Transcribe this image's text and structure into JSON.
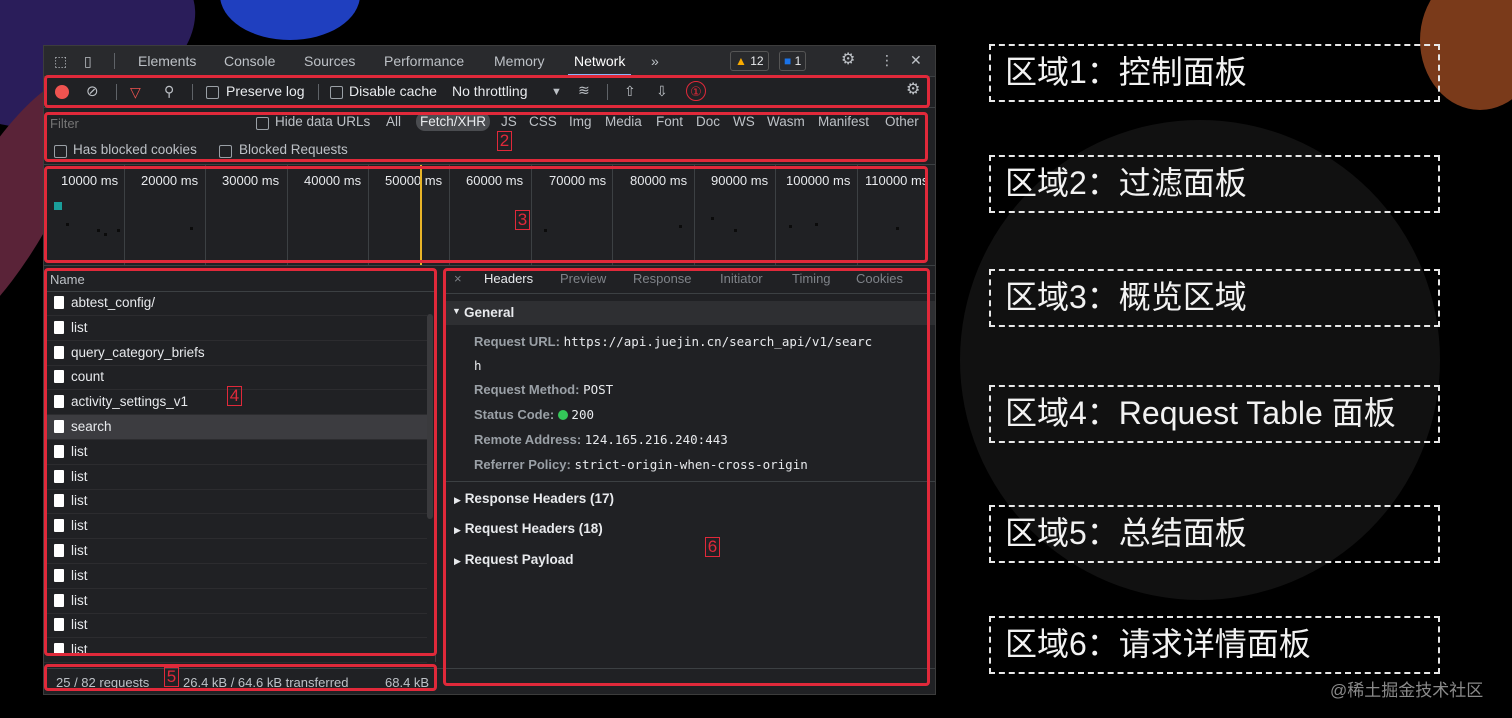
{
  "devtools": {
    "tabs": [
      {
        "label": "Elements",
        "active": false
      },
      {
        "label": "Console",
        "active": false
      },
      {
        "label": "Sources",
        "active": false
      },
      {
        "label": "Performance",
        "active": false
      },
      {
        "label": "Memory",
        "active": false
      },
      {
        "label": "Network",
        "active": true
      }
    ],
    "more_tabs_label": "»",
    "warnings_count": "12",
    "messages_count": "1",
    "toolbar": {
      "preserve_log": "Preserve log",
      "disable_cache": "Disable cache",
      "throttling": "No throttling"
    },
    "filter": {
      "placeholder": "Filter",
      "hide_data_urls": "Hide data URLs",
      "types": [
        "All",
        "Fetch/XHR",
        "JS",
        "CSS",
        "Img",
        "Media",
        "Font",
        "Doc",
        "WS",
        "Wasm",
        "Manifest",
        "Other"
      ],
      "selected_type": "Fetch/XHR",
      "has_blocked_cookies": "Has blocked cookies",
      "blocked_requests": "Blocked Requests"
    },
    "overview": {
      "ticks": [
        "10000 ms",
        "20000 ms",
        "30000 ms",
        "40000 ms",
        "50000 ms",
        "60000 ms",
        "70000 ms",
        "80000 ms",
        "90000 ms",
        "100000 ms",
        "110000 ms"
      ]
    },
    "request_table": {
      "column_name": "Name",
      "rows": [
        {
          "name": "abtest_config/",
          "selected": false
        },
        {
          "name": "list",
          "selected": false
        },
        {
          "name": "query_category_briefs",
          "selected": false
        },
        {
          "name": "count",
          "selected": false
        },
        {
          "name": "activity_settings_v1",
          "selected": false
        },
        {
          "name": "search",
          "selected": true
        },
        {
          "name": "list",
          "selected": false
        },
        {
          "name": "list",
          "selected": false
        },
        {
          "name": "list",
          "selected": false
        },
        {
          "name": "list",
          "selected": false
        },
        {
          "name": "list",
          "selected": false
        },
        {
          "name": "list",
          "selected": false
        },
        {
          "name": "list",
          "selected": false
        },
        {
          "name": "list",
          "selected": false
        },
        {
          "name": "list",
          "selected": false
        }
      ]
    },
    "details": {
      "close": "×",
      "tabs": [
        {
          "label": "Headers",
          "active": true
        },
        {
          "label": "Preview",
          "active": false
        },
        {
          "label": "Response",
          "active": false
        },
        {
          "label": "Initiator",
          "active": false
        },
        {
          "label": "Timing",
          "active": false
        },
        {
          "label": "Cookies",
          "active": false
        }
      ],
      "general_title": "General",
      "general": [
        {
          "key": "Request URL:",
          "value": "https://api.juejin.cn/search_api/v1/searc"
        },
        {
          "key": "",
          "value": "h"
        },
        {
          "key": "Request Method:",
          "value": "POST"
        },
        {
          "key": "Status Code:",
          "value": "200"
        },
        {
          "key": "Remote Address:",
          "value": "124.165.216.240:443"
        },
        {
          "key": "Referrer Policy:",
          "value": "strict-origin-when-cross-origin"
        }
      ],
      "sections": [
        "Response Headers (17)",
        "Request Headers (18)",
        "Request Payload"
      ]
    },
    "status": {
      "requests": "25 / 82 requests",
      "transferred": "26.4 kB / 64.6 kB transferred",
      "resources": "68.4 kB"
    }
  },
  "annotations": {
    "markers": [
      "①",
      "2",
      "3",
      "4",
      "5",
      "6"
    ]
  },
  "regions": [
    "区域1：控制面板",
    "区域2：过滤面板",
    "区域3：概览区域",
    "区域4：Request Table 面板",
    "区域5：总结面板",
    "区域6：请求详情面板"
  ],
  "watermark": "@稀土掘金技术社区",
  "colors": {
    "accent_red": "#e0293a",
    "record_red": "#ef5350",
    "status_green": "#34c759",
    "timeline_marker": "#e8b528",
    "tab_underline": "#8ab4f8"
  }
}
